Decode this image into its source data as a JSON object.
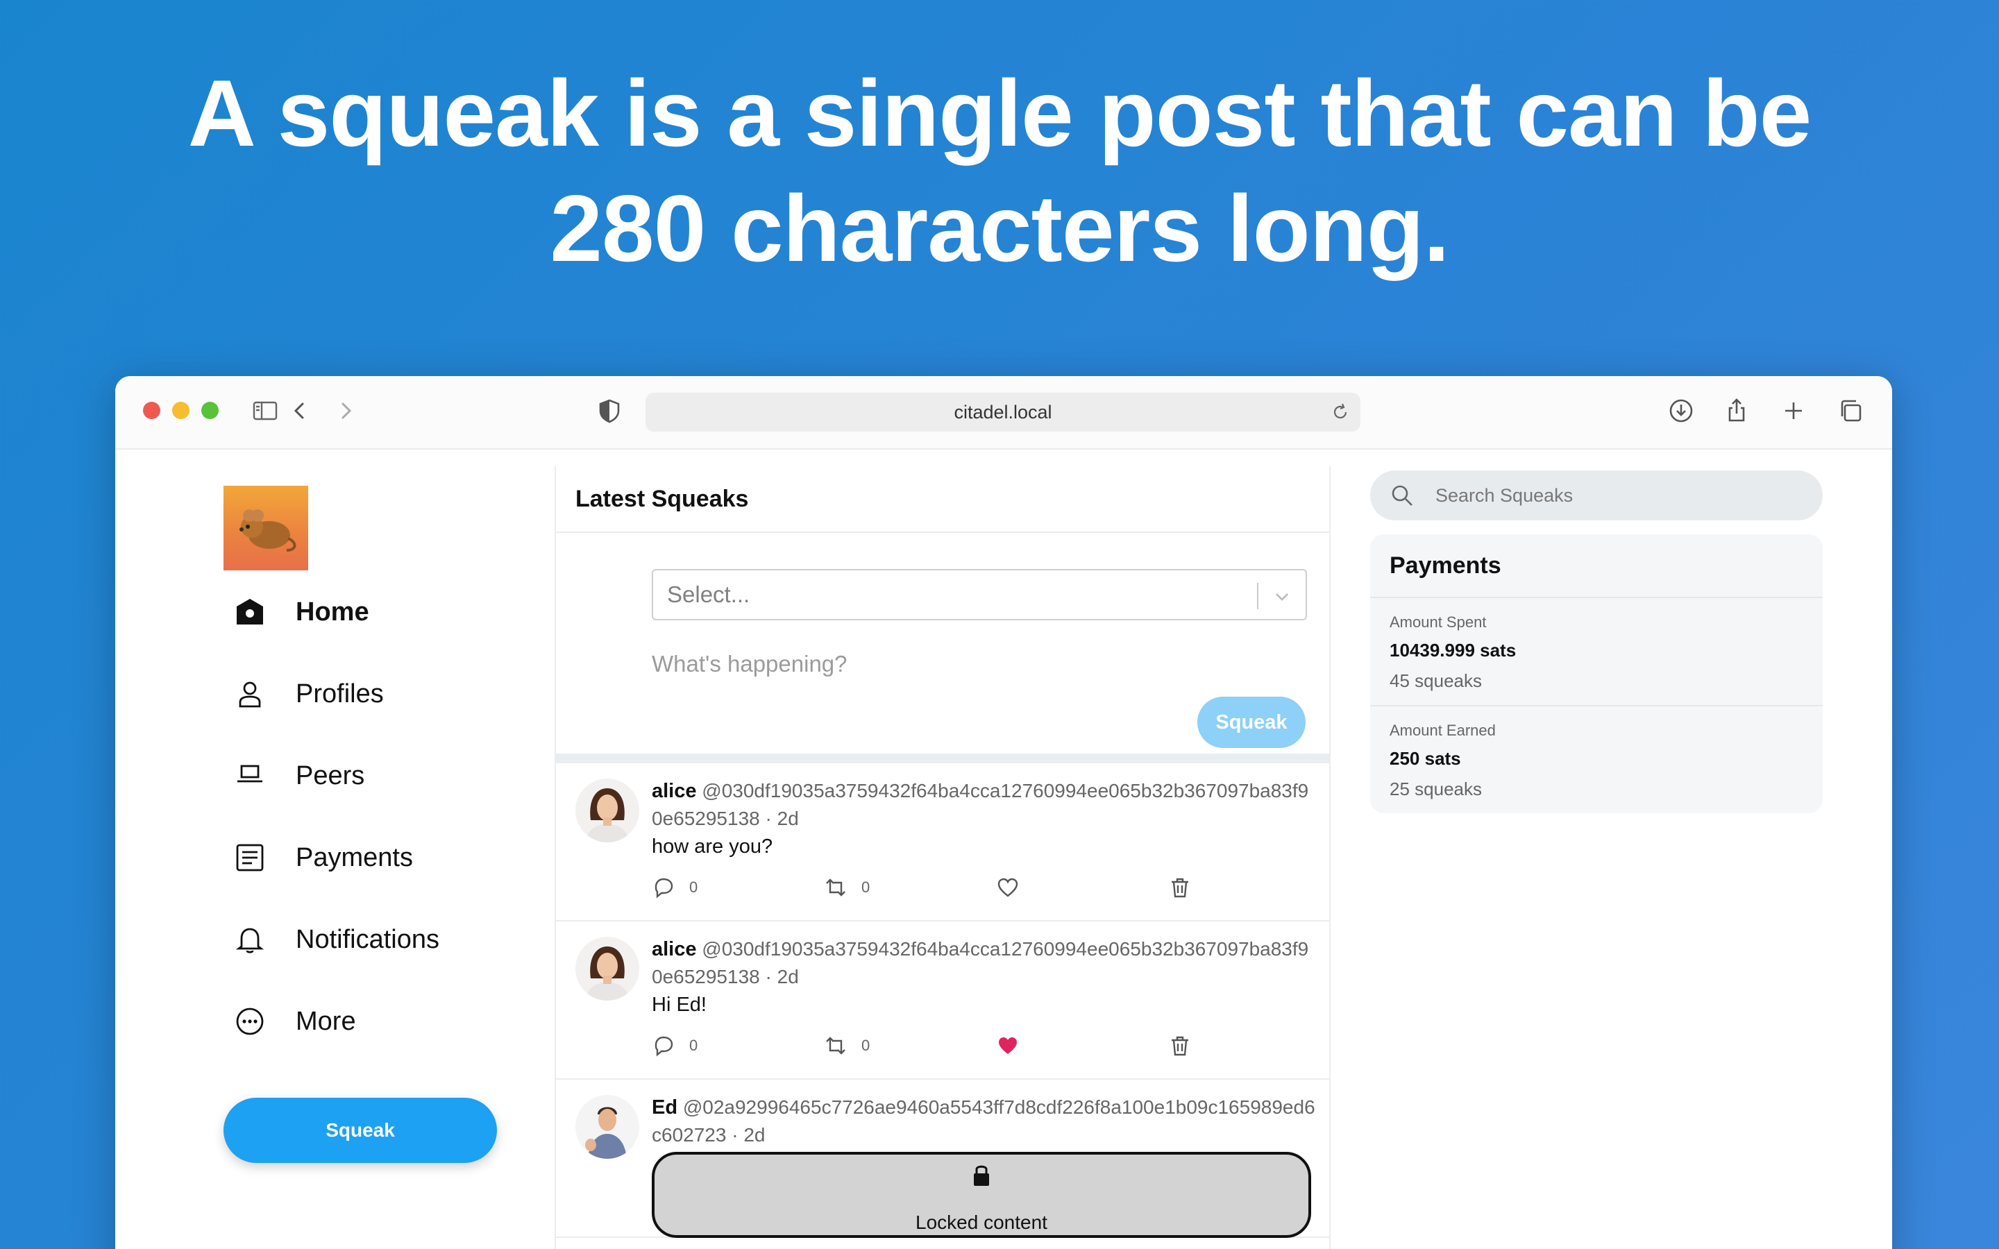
{
  "headline": {
    "line1": "A squeak is a single post that can be",
    "line2": "280 characters long."
  },
  "browser": {
    "url": "citadel.local"
  },
  "nav": {
    "items": [
      {
        "label": "Home",
        "icon": "home-icon"
      },
      {
        "label": "Profiles",
        "icon": "person-icon"
      },
      {
        "label": "Peers",
        "icon": "laptop-icon"
      },
      {
        "label": "Payments",
        "icon": "document-icon"
      },
      {
        "label": "Notifications",
        "icon": "bell-icon"
      },
      {
        "label": "More",
        "icon": "more-icon"
      }
    ],
    "squeak_button": "Squeak"
  },
  "feed": {
    "title": "Latest Squeaks",
    "composer": {
      "select_placeholder": "Select...",
      "text_placeholder": "What's happening?",
      "submit_label": "Squeak"
    },
    "posts": [
      {
        "name": "alice",
        "handle": "@030df19035a3759432f64ba4cca12760994ee065b32b367097ba83f90e65295138",
        "time": "· 2d",
        "text": "how are you?",
        "replies": "0",
        "resqueaks": "0",
        "liked": false
      },
      {
        "name": "alice",
        "handle": "@030df19035a3759432f64ba4cca12760994ee065b32b367097ba83f90e65295138",
        "time": "· 2d",
        "text": "Hi Ed!",
        "replies": "0",
        "resqueaks": "0",
        "liked": true
      },
      {
        "name": "Ed",
        "handle": "@02a92996465c7726ae9460a5543ff7d8cdf226f8a100e1b09c165989ed6c602723",
        "time": "· 2d",
        "locked_text": "Locked content"
      }
    ]
  },
  "sidebar": {
    "search_placeholder": "Search Squeaks",
    "payments": {
      "title": "Payments",
      "rows": [
        {
          "label": "Amount Spent",
          "amount": "10439.999 sats",
          "count": "45 squeaks"
        },
        {
          "label": "Amount Earned",
          "amount": "250 sats",
          "count": "25 squeaks"
        }
      ]
    }
  },
  "colors": {
    "accent": "#1da1f2",
    "like": "#e0245e",
    "background": "#2283d4"
  }
}
